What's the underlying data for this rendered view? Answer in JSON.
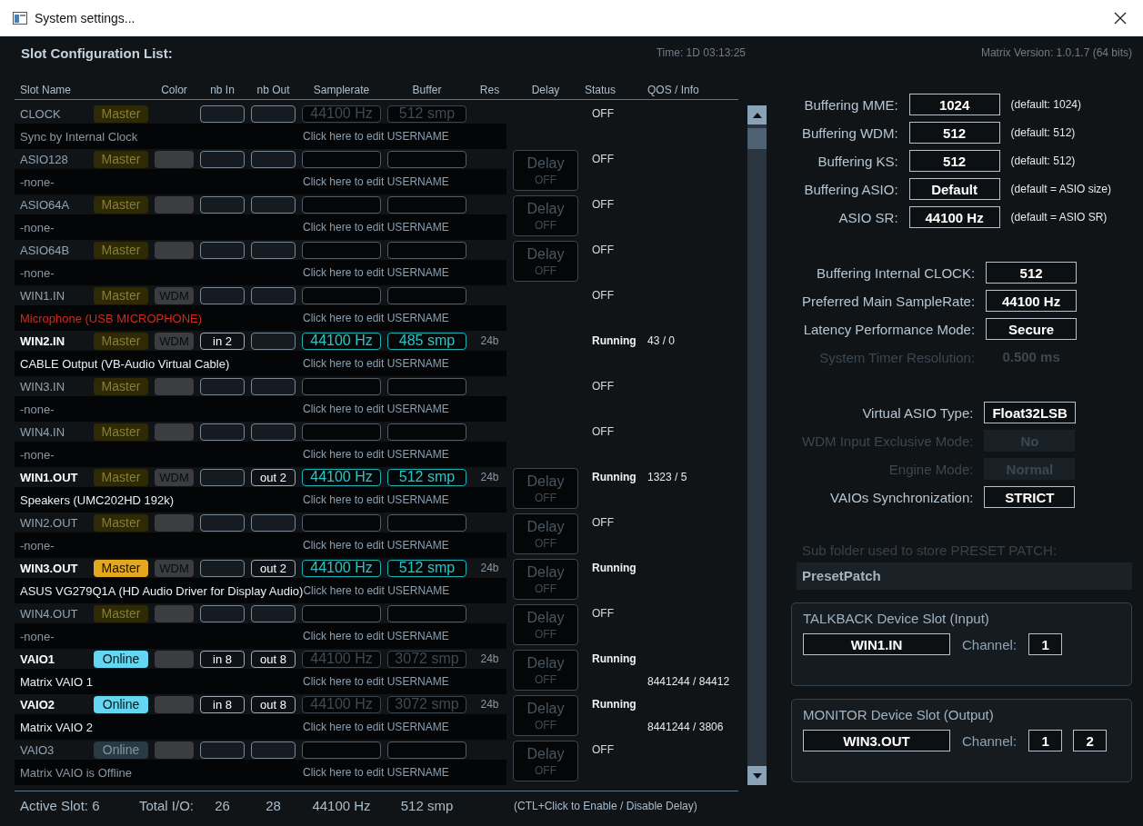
{
  "window": {
    "title": "System settings..."
  },
  "header": {
    "title": "Slot Configuration List:",
    "time": "Time: 1D 03:13:25",
    "version": "Matrix Version: 1.0.1.7 (64 bits)"
  },
  "columns": [
    "Slot Name",
    "Color",
    "nb In",
    "nb Out",
    "Samplerate",
    "Buffer",
    "Res",
    "Delay",
    "Status",
    "QOS / Info"
  ],
  "slots": [
    {
      "name": "CLOCK",
      "active": false,
      "badge": {
        "kind": "master",
        "label": "Master",
        "on": false
      },
      "rate": "44100 Hz",
      "buffer": "512 smp",
      "rate_live": false,
      "status": "OFF",
      "description": "Sync by Internal Clock",
      "desc_bright": false,
      "desc_error": false,
      "username": "Click here to edit USERNAME"
    },
    {
      "name": "ASIO128",
      "active": false,
      "badge": {
        "kind": "master",
        "label": "Master",
        "on": false
      },
      "swatch": true,
      "delay": {
        "label": "Delay",
        "state": "OFF"
      },
      "status": "OFF",
      "description": "-none-",
      "desc_bright": false,
      "desc_error": false,
      "username": "Click here to edit USERNAME"
    },
    {
      "name": "ASIO64A",
      "active": false,
      "badge": {
        "kind": "master",
        "label": "Master",
        "on": false
      },
      "swatch": true,
      "delay": {
        "label": "Delay",
        "state": "OFF"
      },
      "status": "OFF",
      "description": "-none-",
      "desc_bright": false,
      "desc_error": false,
      "username": "Click here to edit USERNAME"
    },
    {
      "name": "ASIO64B",
      "active": false,
      "badge": {
        "kind": "master",
        "label": "Master",
        "on": false
      },
      "swatch": true,
      "delay": {
        "label": "Delay",
        "state": "OFF"
      },
      "status": "OFF",
      "description": "-none-",
      "desc_bright": false,
      "desc_error": false,
      "username": "Click here to edit USERNAME"
    },
    {
      "name": "WIN1.IN",
      "active": false,
      "badge": {
        "kind": "master",
        "label": "Master",
        "on": false
      },
      "tag": "WDM",
      "status": "OFF",
      "description": "Microphone (USB MICROPHONE)",
      "desc_bright": false,
      "desc_error": true,
      "username": "Click here to edit USERNAME"
    },
    {
      "name": "WIN2.IN",
      "active": true,
      "badge": {
        "kind": "master",
        "label": "Master",
        "on": false
      },
      "tag": "WDM",
      "nb_in": "in 2",
      "rate": "44100 Hz",
      "buffer": "485 smp",
      "rate_live": true,
      "res": "24b",
      "status": "Running",
      "qos": "43 / 0",
      "description": "CABLE Output (VB-Audio Virtual Cable)",
      "desc_bright": true,
      "desc_error": false,
      "username": "Click here to edit USERNAME"
    },
    {
      "name": "WIN3.IN",
      "active": false,
      "badge": {
        "kind": "master",
        "label": "Master",
        "on": false
      },
      "swatch": true,
      "status": "OFF",
      "description": "-none-",
      "desc_bright": false,
      "desc_error": false,
      "username": "Click here to edit USERNAME"
    },
    {
      "name": "WIN4.IN",
      "active": false,
      "badge": {
        "kind": "master",
        "label": "Master",
        "on": false
      },
      "swatch": true,
      "status": "OFF",
      "description": "-none-",
      "desc_bright": false,
      "desc_error": false,
      "username": "Click here to edit USERNAME"
    },
    {
      "name": "WIN1.OUT",
      "active": true,
      "badge": {
        "kind": "master",
        "label": "Master",
        "on": false
      },
      "tag": "WDM",
      "nb_out": "out 2",
      "rate": "44100 Hz",
      "buffer": "512 smp",
      "rate_live": true,
      "res": "24b",
      "delay": {
        "label": "Delay",
        "state": "OFF"
      },
      "status": "Running",
      "qos": "1323 / 5",
      "description": "Speakers (UMC202HD 192k)",
      "desc_bright": true,
      "desc_error": false,
      "username": "Click here to edit USERNAME"
    },
    {
      "name": "WIN2.OUT",
      "active": false,
      "badge": {
        "kind": "master",
        "label": "Master",
        "on": false
      },
      "swatch": true,
      "delay": {
        "label": "Delay",
        "state": "OFF"
      },
      "status": "OFF",
      "description": "-none-",
      "desc_bright": false,
      "desc_error": false,
      "username": "Click here to edit USERNAME"
    },
    {
      "name": "WIN3.OUT",
      "active": true,
      "badge": {
        "kind": "master",
        "label": "Master",
        "on": true
      },
      "tag": "WDM",
      "nb_out": "out 2",
      "rate": "44100 Hz",
      "buffer": "512 smp",
      "rate_live": true,
      "res": "24b",
      "delay": {
        "label": "Delay",
        "state": "OFF"
      },
      "status": "Running",
      "description": "ASUS VG279Q1A (HD Audio Driver for Display Audio)",
      "desc_bright": true,
      "desc_error": false,
      "username": "Click here to edit USERNAME"
    },
    {
      "name": "WIN4.OUT",
      "active": false,
      "badge": {
        "kind": "master",
        "label": "Master",
        "on": false
      },
      "swatch": true,
      "delay": {
        "label": "Delay",
        "state": "OFF"
      },
      "status": "OFF",
      "description": "-none-",
      "desc_bright": false,
      "desc_error": false,
      "username": "Click here to edit USERNAME"
    },
    {
      "name": "VAIO1",
      "active": true,
      "badge": {
        "kind": "online",
        "label": "Online",
        "on": true
      },
      "swatch": true,
      "nb_in": "in 8",
      "nb_out": "out 8",
      "rate": "44100 Hz",
      "buffer": "3072 smp",
      "rate_live": false,
      "res": "24b",
      "delay": {
        "label": "Delay",
        "state": "OFF"
      },
      "status": "Running",
      "info": "8441244 / 84412",
      "description": "Matrix VAIO 1",
      "desc_bright": true,
      "desc_error": false,
      "username": "Click here to edit USERNAME"
    },
    {
      "name": "VAIO2",
      "active": true,
      "badge": {
        "kind": "online",
        "label": "Online",
        "on": true
      },
      "swatch": true,
      "nb_in": "in 8",
      "nb_out": "out 8",
      "rate": "44100 Hz",
      "buffer": "3072 smp",
      "rate_live": false,
      "res": "24b",
      "delay": {
        "label": "Delay",
        "state": "OFF"
      },
      "status": "Running",
      "info": "8441244 / 3806",
      "description": "Matrix VAIO 2",
      "desc_bright": true,
      "desc_error": false,
      "username": "Click here to edit USERNAME"
    },
    {
      "name": "VAIO3",
      "active": false,
      "badge": {
        "kind": "online",
        "label": "Online",
        "on": false
      },
      "swatch": true,
      "delay": {
        "label": "Delay",
        "state": "OFF"
      },
      "status": "OFF",
      "description": "Matrix VAIO is Offline",
      "desc_bright": false,
      "desc_error": false,
      "username": "Click here to edit USERNAME"
    }
  ],
  "footer": {
    "active_slot": "Active Slot: 6",
    "total_label": "Total I/O:",
    "total_in": "26",
    "total_out": "28",
    "rate": "44100 Hz",
    "buffer": "512 smp",
    "hint": "(CTL+Click to Enable / Disable Delay)"
  },
  "settings": [
    {
      "rows": [
        {
          "label": "Buffering MME:",
          "value": "1024",
          "note": "(default: 1024)",
          "kind": "field",
          "disabled": false
        },
        {
          "label": "Buffering WDM:",
          "value": "512",
          "note": "(default: 512)",
          "kind": "field",
          "disabled": false
        },
        {
          "label": "Buffering KS:",
          "value": "512",
          "note": "(default: 512)",
          "kind": "field",
          "disabled": false
        },
        {
          "label": "Buffering ASIO:",
          "value": "Default",
          "note": "(default = ASIO size)",
          "kind": "field",
          "disabled": false
        },
        {
          "label": "ASIO SR:",
          "value": "44100 Hz",
          "note": "(default = ASIO SR)",
          "kind": "field",
          "disabled": false
        }
      ]
    },
    {
      "rows": [
        {
          "label": "Buffering Internal CLOCK:",
          "value": "512",
          "kind": "field",
          "disabled": false
        },
        {
          "label": "Preferred Main SampleRate:",
          "value": "44100 Hz",
          "kind": "field",
          "disabled": false
        },
        {
          "label": "Latency Performance Mode:",
          "value": "Secure",
          "kind": "field",
          "disabled": false
        },
        {
          "label": "System Timer Resolution:",
          "value": "0.500 ms",
          "kind": "readout",
          "disabled": true
        }
      ]
    },
    {
      "rows": [
        {
          "label": "Virtual ASIO Type:",
          "value": "Float32LSB",
          "kind": "field",
          "disabled": false
        },
        {
          "label": "WDM Input Exclusive Mode:",
          "value": "No",
          "kind": "field",
          "disabled": true
        },
        {
          "label": "Engine Mode:",
          "value": "Normal",
          "kind": "field",
          "disabled": true
        },
        {
          "label": "VAIOs Synchronization:",
          "value": "STRICT",
          "kind": "field",
          "disabled": false
        }
      ]
    }
  ],
  "preset": {
    "label": "Sub folder used to store PRESET PATCH:",
    "value": "PresetPatch"
  },
  "devices": [
    {
      "title": "TALKBACK Device Slot (Input)",
      "slot": "WIN1.IN",
      "channel_label": "Channel:",
      "channels": [
        "1"
      ]
    },
    {
      "title": "MONITOR Device Slot (Output)",
      "slot": "WIN3.OUT",
      "channel_label": "Channel:",
      "channels": [
        "1",
        "2"
      ]
    }
  ]
}
